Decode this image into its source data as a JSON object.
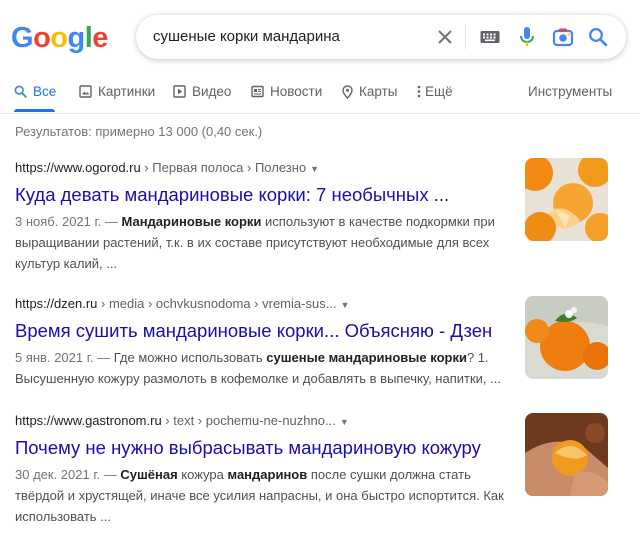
{
  "logo": "Google",
  "search": {
    "query": "сушеные корки мандарина"
  },
  "tabs": {
    "all": "Все",
    "images": "Картинки",
    "video": "Видео",
    "news": "Новости",
    "maps": "Карты",
    "more": "Ещё",
    "tools": "Инструменты"
  },
  "stats": "Результатов: примерно 13 000 (0,40 сек.)",
  "results": [
    {
      "domain": "https://www.ogorod.ru",
      "path": " › Первая полоса › Полезно",
      "title": "Куда девать мандариновые корки: 7 необычных ...",
      "date": "3 нояб. 2021 г. — ",
      "s1": "",
      "b1": "Мандариновые корки",
      "s2": " используют в качестве подкормки при выращивании растений, т.к. в их составе присутствуют необходимые для всех культур калий, ...",
      "b2": "",
      "s3": ""
    },
    {
      "domain": "https://dzen.ru",
      "path": " › media › ochvkusnodoma › vremia-sus...",
      "title": "Время сушить мандариновые корки... Объясняю - Дзен",
      "date": "5 янв. 2021 г. — ",
      "s1": "Где можно использовать ",
      "b1": "сушеные мандариновые корки",
      "s2": "? 1. Высушенную кожуру размолоть в кофемолке и добавлять в выпечку, напитки, ...",
      "b2": "",
      "s3": ""
    },
    {
      "domain": "https://www.gastronom.ru",
      "path": " › text › pochemu-ne-nuzhno...",
      "title": "Почему не нужно выбрасывать мандариновую кожуру",
      "date": "30 дек. 2021 г. — ",
      "s1": "",
      "b1": "Сушёная",
      "s2": " кожура ",
      "b2": "мандаринов",
      "s3": " после сушки должна стать твёрдой и хрустящей, иначе все усилия напрасны, и она быстро испортится. Как использовать ..."
    }
  ],
  "colors": {
    "link": "#1a0dab",
    "accent": "#1a73e8",
    "google_blue": "#4285f4",
    "google_red": "#ea4335",
    "google_yellow": "#fbbc05",
    "google_green": "#34a853"
  },
  "icons": [
    "clear-icon",
    "keyboard-icon",
    "microphone-icon",
    "camera-icon",
    "search-icon",
    "image-icon",
    "video-icon",
    "news-icon",
    "map-pin-icon",
    "more-dots-icon",
    "dropdown-arrow-icon"
  ]
}
